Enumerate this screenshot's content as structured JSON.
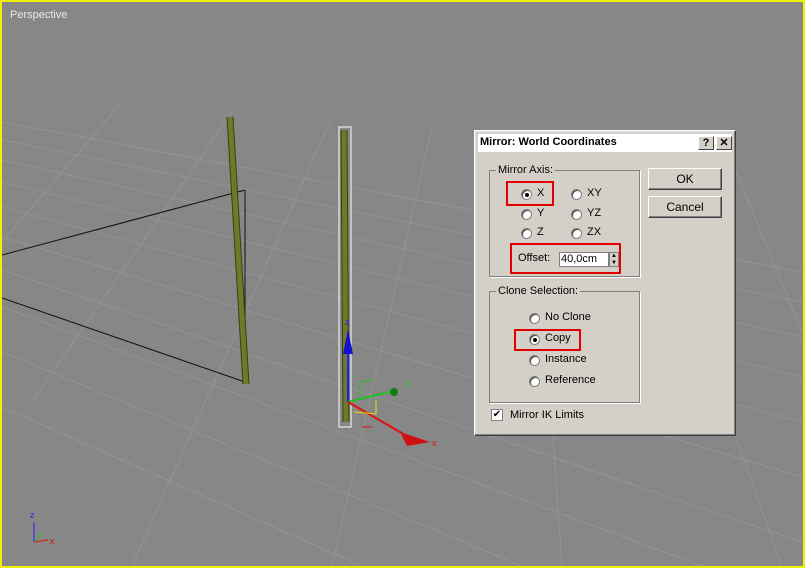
{
  "viewport": {
    "label": "Perspective"
  },
  "gizmo": {
    "y": "y",
    "z": "z",
    "x": "x"
  },
  "axis_indicator": {
    "z": "z",
    "x": "x"
  },
  "dialog": {
    "title": "Mirror: World Coordinates",
    "help_button": "?",
    "close_button": "✕",
    "mirror_axis": {
      "label": "Mirror Axis:",
      "options": [
        "X",
        "Y",
        "Z",
        "XY",
        "YZ",
        "ZX"
      ],
      "selected": "X",
      "offset_label": "Offset:",
      "offset_value": "40,0cm"
    },
    "ok_label": "OK",
    "cancel_label": "Cancel",
    "clone_selection": {
      "label": "Clone Selection:",
      "options": [
        "No Clone",
        "Copy",
        "Instance",
        "Reference"
      ],
      "selected": "Copy"
    },
    "mirror_ik": {
      "label": "Mirror IK Limits",
      "checked": true
    }
  },
  "colors": {
    "viewport_border": "#f0f000",
    "highlight": "#e00000",
    "pole": "#6e7a2a",
    "dialog_bg": "#d4d0c8"
  }
}
